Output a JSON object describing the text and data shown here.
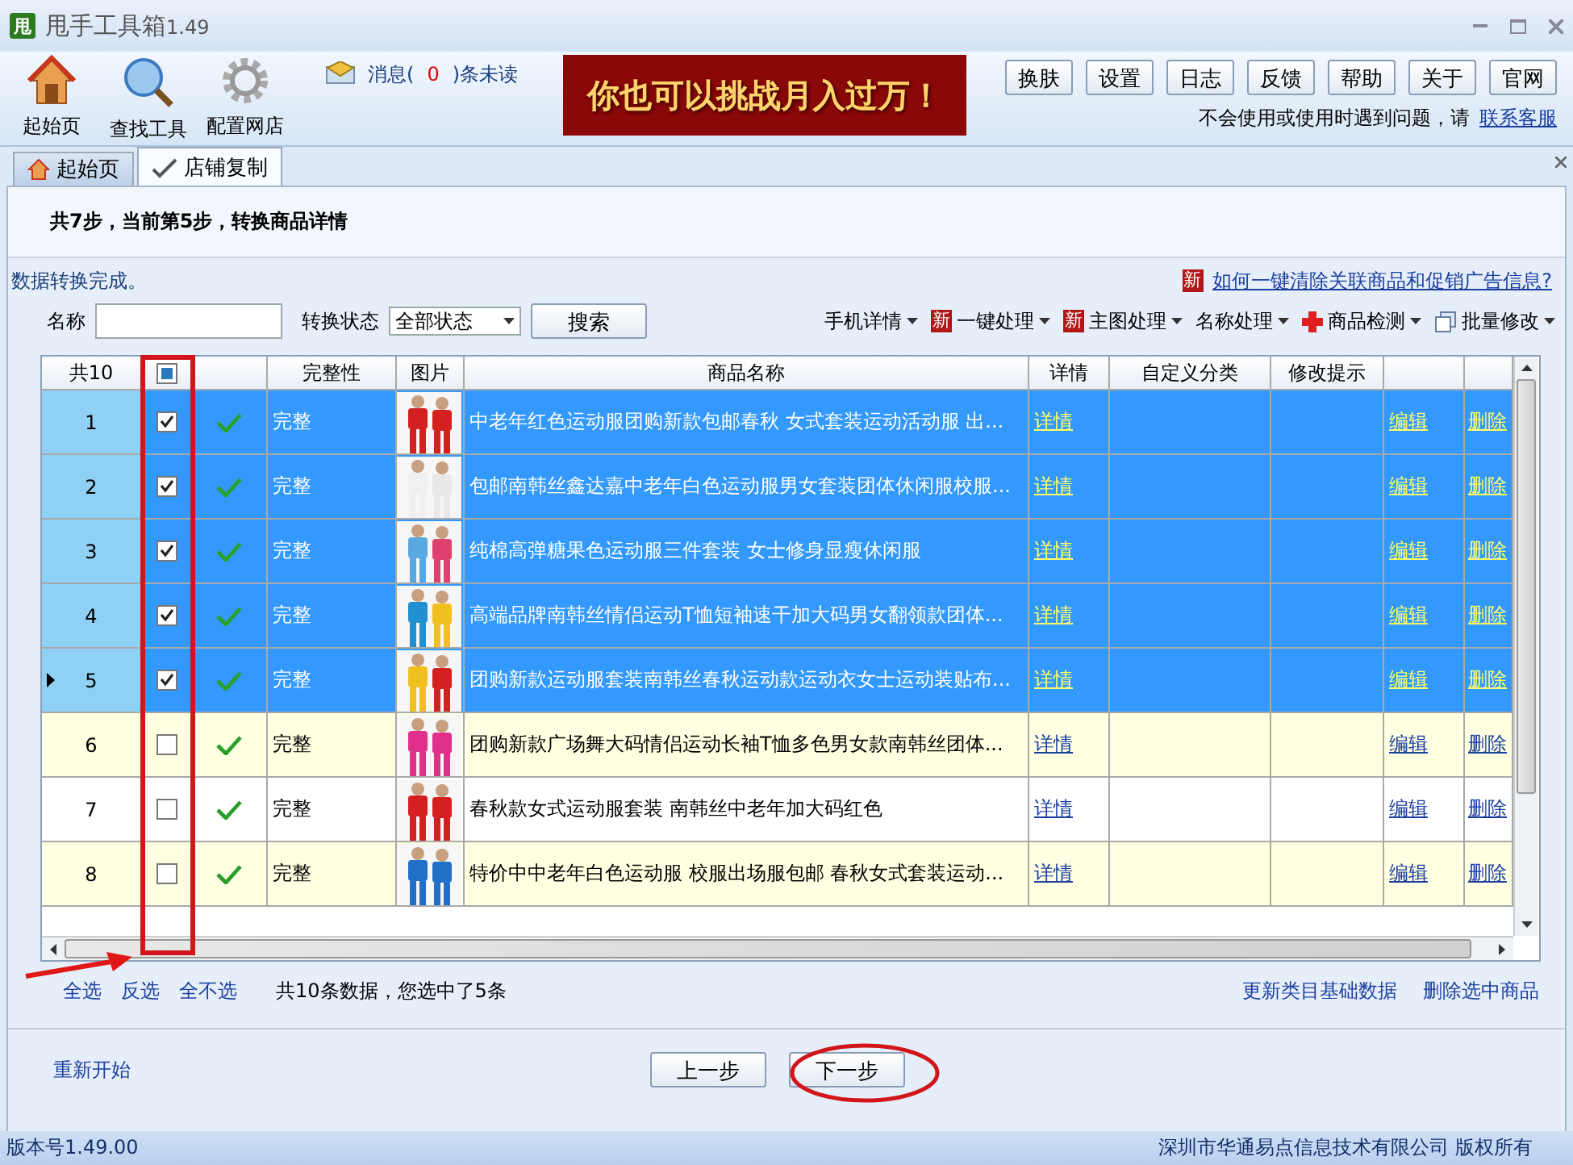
{
  "window": {
    "title": "甩手工具箱",
    "version": "1.49",
    "logo": "甩"
  },
  "toolbar": {
    "tools": [
      {
        "label": "起始页",
        "kind": "home"
      },
      {
        "label": "查找工具",
        "kind": "search"
      },
      {
        "label": "配置网店",
        "kind": "gear"
      }
    ],
    "message": {
      "prefix": "消息(",
      "count": "0",
      "suffix": ")条未读"
    },
    "banner": "你也可以挑战月入过万！",
    "buttons": [
      "换肤",
      "设置",
      "日志",
      "反馈",
      "帮助",
      "关于",
      "官网"
    ],
    "help": {
      "text": "不会使用或使用时遇到问题，请",
      "link": "联系客服"
    }
  },
  "tabs": [
    {
      "label": "起始页",
      "selected": false,
      "kind": "home"
    },
    {
      "label": "店铺复制",
      "selected": true,
      "kind": "edit"
    }
  ],
  "step": "共7步，当前第5步，转换商品详情",
  "status_message": "数据转换完成。",
  "promo": {
    "badge": "新",
    "link": "如何一键清除关联商品和促销广告信息?"
  },
  "filter": {
    "name_label": "名称",
    "status_label": "转换状态",
    "status_value": "全部状态",
    "search_button": "搜索"
  },
  "actions": [
    {
      "label": "手机详情",
      "kind": "plain"
    },
    {
      "label": "一键处理",
      "kind": "new",
      "badge": "新"
    },
    {
      "label": "主图处理",
      "kind": "new",
      "badge": "新"
    },
    {
      "label": "名称处理",
      "kind": "plain"
    },
    {
      "label": "商品检测",
      "kind": "cross"
    },
    {
      "label": "批量修改",
      "kind": "pages"
    }
  ],
  "table": {
    "count": "共10",
    "header_check": {
      "checked": false,
      "indeterminate": true
    },
    "columns": [
      "完整性",
      "图片",
      "商品名称",
      "详情",
      "自定义分类",
      "修改提示"
    ],
    "rows": [
      {
        "number": "1",
        "selected": true,
        "checked": true,
        "current": false,
        "status": "完整",
        "name": "中老年红色运动服团购新款包邮春秋 女式套装运动活动服 出...",
        "detail": "详情",
        "edit": "编辑",
        "delete": "删除"
      },
      {
        "number": "2",
        "selected": true,
        "checked": true,
        "current": false,
        "status": "完整",
        "name": "包邮南韩丝鑫达嘉中老年白色运动服男女套装团体休闲服校服...",
        "detail": "详情",
        "edit": "编辑",
        "delete": "删除"
      },
      {
        "number": "3",
        "selected": true,
        "checked": true,
        "current": false,
        "status": "完整",
        "name": "纯棉高弹糖果色运动服三件套装 女士修身显瘦休闲服",
        "detail": "详情",
        "edit": "编辑",
        "delete": "删除"
      },
      {
        "number": "4",
        "selected": true,
        "checked": true,
        "current": false,
        "status": "完整",
        "name": "高端品牌南韩丝情侣运动T恤短袖速干加大码男女翻领款团体...",
        "detail": "详情",
        "edit": "编辑",
        "delete": "删除"
      },
      {
        "number": "5",
        "selected": true,
        "checked": true,
        "current": true,
        "status": "完整",
        "name": "团购新款运动服套装南韩丝春秋运动款运动衣女士运动装贴布...",
        "detail": "详情",
        "edit": "编辑",
        "delete": "删除"
      },
      {
        "number": "6",
        "selected": false,
        "checked": false,
        "current": false,
        "status": "完整",
        "name": "团购新款广场舞大码情侣运动长袖T恤多色男女款南韩丝团体...",
        "detail": "详情",
        "edit": "编辑",
        "delete": "删除"
      },
      {
        "number": "7",
        "selected": false,
        "checked": false,
        "current": false,
        "status": "完整",
        "name": "春秋款女式运动服套装 南韩丝中老年加大码红色",
        "detail": "详情",
        "edit": "编辑",
        "delete": "删除"
      },
      {
        "number": "8",
        "selected": false,
        "checked": false,
        "current": false,
        "status": "完整",
        "name": "特价中中老年白色运动服 校服出场服包邮 春秋女式套装运动...",
        "detail": "详情",
        "edit": "编辑",
        "delete": "删除"
      }
    ]
  },
  "selection": {
    "links": [
      "全选",
      "反选",
      "全不选"
    ],
    "summary": "共10条数据，您选中了5条",
    "right_links": [
      "更新类目基础数据",
      "删除选中商品"
    ]
  },
  "restart": "重新开始",
  "nav_buttons": [
    "上一步",
    "下一步"
  ],
  "status_bar": {
    "version": "版本号1.49.00",
    "company": "深圳市华通易点信息技术有限公司 版权所有"
  }
}
